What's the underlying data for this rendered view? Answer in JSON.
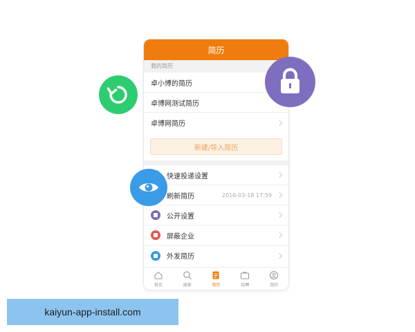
{
  "app": {
    "title": "简历"
  },
  "resumes": {
    "section_label": "我的简历",
    "items": [
      {
        "label": "卓小博的简历"
      },
      {
        "label": "卓博网测试简历"
      },
      {
        "label": "卓博网简历"
      }
    ],
    "new_button": "新建/导入简历"
  },
  "settings": {
    "items": [
      {
        "label": "快速投递设置",
        "icon": "send-settings-icon",
        "color": "#5b9bd5",
        "date": ""
      },
      {
        "label": "刷新简历",
        "icon": "refresh-icon",
        "color": "#2ec27e",
        "date": "2016-03-18  17:59"
      },
      {
        "label": "公开设置",
        "icon": "public-icon",
        "color": "#7e6bb5",
        "date": ""
      },
      {
        "label": "屏蔽企业",
        "icon": "block-icon",
        "color": "#e05a4f",
        "date": ""
      },
      {
        "label": "外发简历",
        "icon": "send-icon",
        "color": "#3a9ad9",
        "date": ""
      }
    ]
  },
  "tabs": [
    {
      "label": "首页",
      "icon": "home-icon",
      "active": false
    },
    {
      "label": "搜索",
      "icon": "search-icon",
      "active": false
    },
    {
      "label": "简历",
      "icon": "resume-icon",
      "active": true
    },
    {
      "label": "招聘",
      "icon": "briefcase-icon",
      "active": false
    },
    {
      "label": "我的",
      "icon": "user-icon",
      "active": false
    }
  ],
  "floating_icons": [
    {
      "name": "refresh-icon",
      "color": "#2ecc71"
    },
    {
      "name": "lock-icon",
      "color": "#7f6ec0"
    },
    {
      "name": "eye-icon",
      "color": "#3a9be6"
    }
  ],
  "colors": {
    "brand": "#f07c0f",
    "watermark_bg": "#8cc4ef"
  },
  "watermark": {
    "text": "kaiyun-app-install.com"
  }
}
